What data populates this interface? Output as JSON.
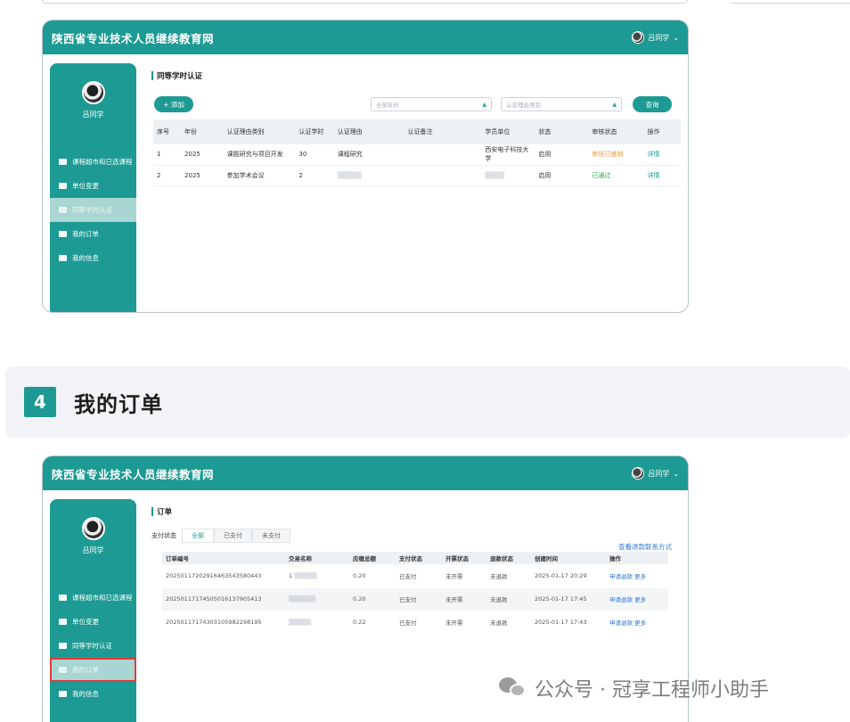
{
  "site": {
    "title": "陕西省专业技术人员继续教育网",
    "user": "吕同学"
  },
  "sidebar": {
    "user_name": "吕同学",
    "items": [
      {
        "label": "课程超市和已选课程"
      },
      {
        "label": "单位变更"
      },
      {
        "label": "同等学时认证"
      },
      {
        "label": "我的订单"
      },
      {
        "label": "我的信息"
      }
    ]
  },
  "screen1": {
    "title": "同等学时认证",
    "add_label": "+ 添加",
    "year_placeholder": "全部年份",
    "type_placeholder": "认证理由类别",
    "query_label": "查询",
    "columns": [
      "序号",
      "年份",
      "认证理由类别",
      "认证学时",
      "认证理由",
      "认证备注",
      "学员单位",
      "状态",
      "审核状态",
      "操作"
    ],
    "rows": [
      {
        "no": "1",
        "year": "2025",
        "type": "课题研究与项目开发",
        "hours": "30",
        "reason": "课程研究",
        "remark": "",
        "unit": "西安电子科技大学",
        "status": "启用",
        "audit": "审核已撤销",
        "action": "详情"
      },
      {
        "no": "2",
        "year": "2025",
        "type": "参加学术会议",
        "hours": "2",
        "reason": "",
        "remark": "",
        "unit": "",
        "status": "启用",
        "audit": "已通过",
        "action": "详情"
      }
    ]
  },
  "section": {
    "number": "4",
    "title": "我的订单"
  },
  "screen2": {
    "title": "订单",
    "filter_label": "支付状态",
    "tabs": [
      "全部",
      "已支付",
      "未支付"
    ],
    "contact_link": "查看退款联系方式",
    "columns": [
      "订单编号",
      "交易名称",
      "应缴总额",
      "支付状态",
      "开票状态",
      "退款状态",
      "创建时间",
      "操作"
    ],
    "rows": [
      {
        "order_no": "20250117202916463543580443",
        "name": "1",
        "amount": "0.20",
        "pay": "已支付",
        "invoice": "未开票",
        "refund": "未退款",
        "created": "2025-01-17 20:29",
        "action1": "申请退款",
        "action2": "更多"
      },
      {
        "order_no": "20250117174505016137905413",
        "name": "",
        "amount": "0.20",
        "pay": "已支付",
        "invoice": "未开票",
        "refund": "未退款",
        "created": "2025-01-17 17:45",
        "action1": "申请退款",
        "action2": "更多"
      },
      {
        "order_no": "20250117174303105982298195",
        "name": "",
        "amount": "0.22",
        "pay": "已支付",
        "invoice": "未开票",
        "refund": "未退款",
        "created": "2025-01-17 17:43",
        "action1": "申请退款",
        "action2": "更多"
      }
    ]
  },
  "watermark": {
    "text": "公众号 · 冠享工程师小助手"
  },
  "colors": {
    "primary": "#1d9a93",
    "highlight": "#e23b3b",
    "link": "#2f78d4",
    "warning": "#f29a2e",
    "success": "#23a84d"
  }
}
